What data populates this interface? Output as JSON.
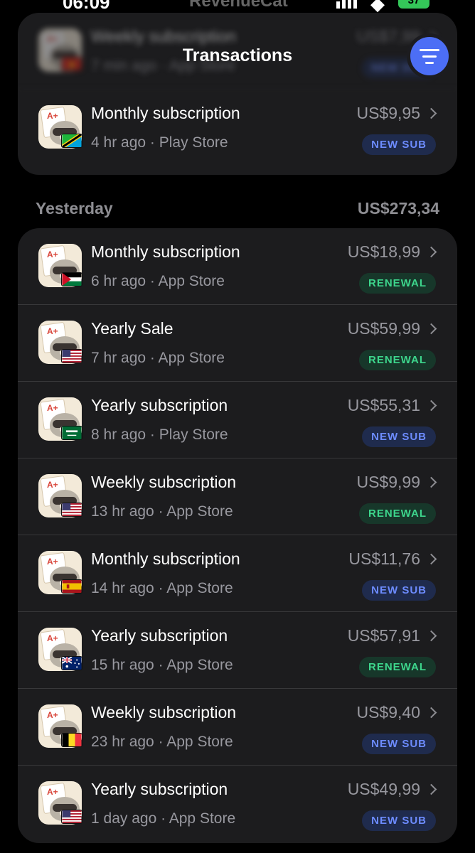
{
  "status_bar": {
    "time": "06:09",
    "app_name": "RevenueCat",
    "battery": "37"
  },
  "header": {
    "title": "Transactions"
  },
  "colors": {
    "accent": "#4c6ef5",
    "card_bg": "#1c1c1e",
    "new_sub_text": "#6d8cff",
    "renewal_text": "#3dd68c"
  },
  "top_group": {
    "rows": [
      {
        "title": "Weekly subscription",
        "meta": "7 min ago · App Store",
        "amount": "US$7,99",
        "badge": "NEW SUB",
        "badge_type": "new",
        "flag": "vietnam",
        "blurred": true
      },
      {
        "title": "Monthly subscription",
        "meta": "4 hr ago · Play Store",
        "amount": "US$9,95",
        "badge": "NEW SUB",
        "badge_type": "new",
        "flag": "tanzania",
        "blurred": false
      }
    ]
  },
  "section": {
    "label": "Yesterday",
    "total": "US$273,34",
    "rows": [
      {
        "title": "Monthly subscription",
        "meta": "6 hr ago · App Store",
        "amount": "US$18,99",
        "badge": "RENEWAL",
        "badge_type": "renewal",
        "flag": "jordan"
      },
      {
        "title": "Yearly Sale",
        "meta": "7 hr ago · App Store",
        "amount": "US$59,99",
        "badge": "RENEWAL",
        "badge_type": "renewal",
        "flag": "usa"
      },
      {
        "title": "Yearly subscription",
        "meta": "8 hr ago · Play Store",
        "amount": "US$55,31",
        "badge": "NEW SUB",
        "badge_type": "new",
        "flag": "saudi"
      },
      {
        "title": "Weekly subscription",
        "meta": "13 hr ago · App Store",
        "amount": "US$9,99",
        "badge": "RENEWAL",
        "badge_type": "renewal",
        "flag": "usa"
      },
      {
        "title": "Monthly subscription",
        "meta": "14 hr ago · App Store",
        "amount": "US$11,76",
        "badge": "NEW SUB",
        "badge_type": "new",
        "flag": "spain"
      },
      {
        "title": "Yearly subscription",
        "meta": "15 hr ago · App Store",
        "amount": "US$57,91",
        "badge": "RENEWAL",
        "badge_type": "renewal",
        "flag": "australia"
      },
      {
        "title": "Weekly subscription",
        "meta": "23 hr ago · App Store",
        "amount": "US$9,40",
        "badge": "NEW SUB",
        "badge_type": "new",
        "flag": "belgium"
      },
      {
        "title": "Yearly subscription",
        "meta": "1 day ago · App Store",
        "amount": "US$49,99",
        "badge": "NEW SUB",
        "badge_type": "new",
        "flag": "usa"
      }
    ]
  }
}
